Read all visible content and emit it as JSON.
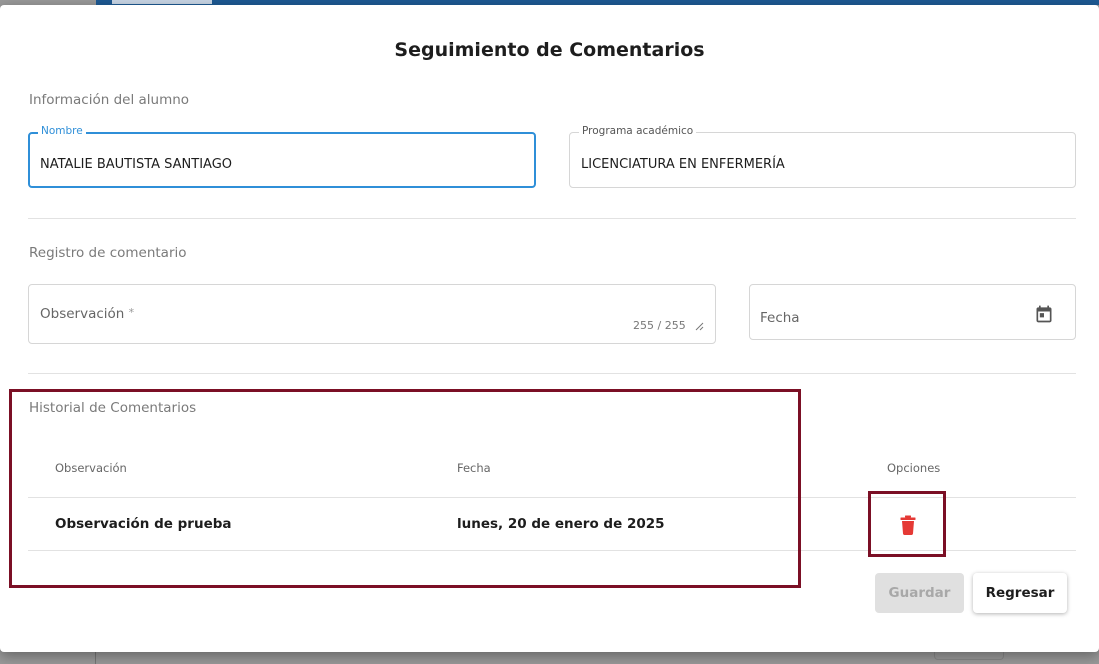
{
  "dialog": {
    "title": "Seguimiento de Comentarios"
  },
  "student_info": {
    "section_title": "Información del alumno",
    "name_label": "Nombre",
    "name_value": "NATALIE BAUTISTA SANTIAGO",
    "program_label": "Programa académico",
    "program_value": "LICENCIATURA EN ENFERMERÍA"
  },
  "comment_form": {
    "section_title": "Registro de comentario",
    "observation_placeholder": "Observación",
    "required_marker": "*",
    "char_counter": "255 / 255",
    "date_placeholder": "Fecha",
    "date_icon": "calendar-icon"
  },
  "history": {
    "section_title": "Historial de Comentarios",
    "columns": [
      "Observación",
      "Fecha",
      "Opciones"
    ],
    "rows": [
      {
        "observation": "Observación de prueba",
        "date": "lunes, 20 de enero de 2025",
        "option_icon": "trash-icon"
      }
    ]
  },
  "actions": {
    "save_label": "Guardar",
    "back_label": "Regresar"
  },
  "colors": {
    "accent": "#2f8fd8",
    "highlight": "#7b0f25",
    "delete": "#e53935",
    "topbar": "#1e5a94"
  }
}
